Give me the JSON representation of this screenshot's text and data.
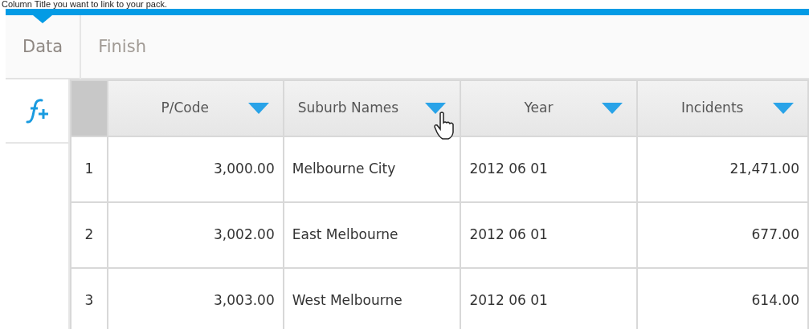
{
  "caption": "Column Title you want to link to your pack.",
  "tabs": [
    {
      "label": "Data",
      "selected": true
    },
    {
      "label": "Finish",
      "selected": false
    }
  ],
  "table": {
    "columns": [
      "P/Code",
      "Suburb Names",
      "Year",
      "Incidents"
    ],
    "rows": [
      {
        "number": "1",
        "cells": [
          "3,000.00",
          "Melbourne City",
          "2012 06 01",
          "21,471.00"
        ]
      },
      {
        "number": "2",
        "cells": [
          "3,002.00",
          "East Melbourne",
          "2012 06 01",
          "677.00"
        ]
      },
      {
        "number": "3",
        "cells": [
          "3,003.00",
          "West Melbourne",
          "2012 06 01",
          "614.00"
        ]
      }
    ]
  }
}
